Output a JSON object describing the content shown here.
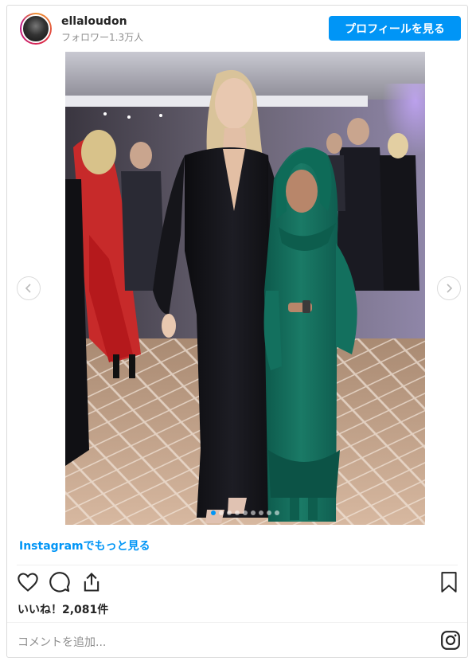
{
  "header": {
    "username": "ellaloudon",
    "followers": "フォロワー1.3万人",
    "profile_button": "プロフィールを見る"
  },
  "carousel": {
    "total": 9,
    "active_index": 0
  },
  "more_link": "Instagramでもっと見る",
  "likes": "いいね！2,081件",
  "comment_placeholder": "コメントを追加...",
  "colors": {
    "accent": "#0095f6",
    "border": "#dbdbdb"
  },
  "icons": [
    "heart-icon",
    "comment-icon",
    "share-icon",
    "bookmark-icon",
    "instagram-icon",
    "chevron-left-icon",
    "chevron-right-icon"
  ]
}
